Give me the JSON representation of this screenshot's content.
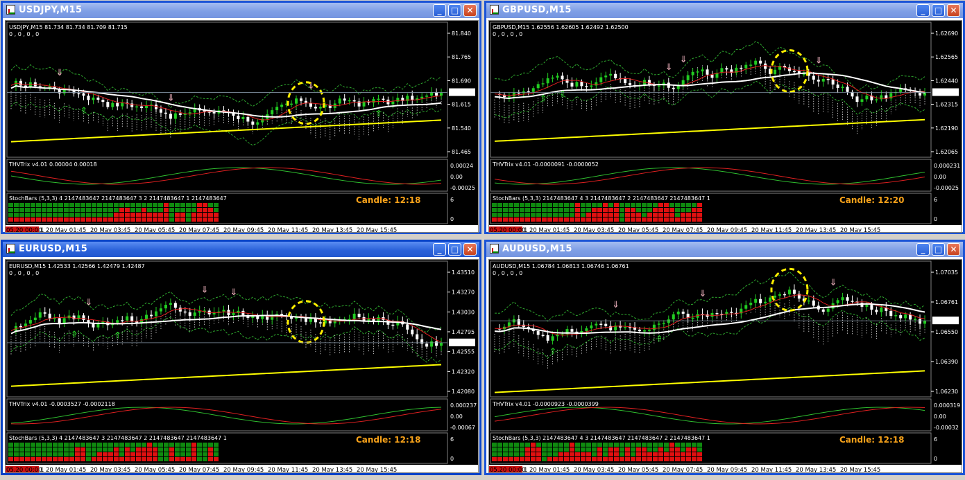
{
  "windows": [
    {
      "id": "usdjpy",
      "title": "USDJPY,M15",
      "header": "USDJPY,M15  81.734 81.734 81.709 81.715",
      "subheader": "0 , 0 , 0 , 0",
      "price_labels": [
        "81.840",
        "81.765",
        "81.690",
        "81.615",
        "81.540",
        "81.465"
      ],
      "current_price": "81.715",
      "indicator": "THVTrix v4.01 0.00004 0.00018",
      "indicator_labels": [
        "0.00024",
        "0.00",
        "-0.00025"
      ],
      "stoch": "StochBars (5,3,3) 4 2147483647 2147483647 3 2 2147483647 1 2147483647",
      "stoch_labels": [
        "6",
        "0"
      ],
      "candle": "Candle:  12:18",
      "time_labels": [
        "05.20 00:00",
        "1",
        "20 May 01:45",
        "20 May 03:45",
        "20 May 05:45",
        "20 May 07:45",
        "20 May 09:45",
        "20 May 11:45",
        "20 May 13:45",
        "20 May 15:45"
      ]
    },
    {
      "id": "gbpusd",
      "title": "GBPUSD,M15",
      "header": "GBPUSD,M15  1.62556 1.62605 1.62492 1.62500",
      "subheader": "0 , 0 , 0 , 0",
      "price_labels": [
        "1.62690",
        "1.62565",
        "1.62440",
        "1.62315",
        "1.62190",
        "1.62065"
      ],
      "current_price": "1.62500",
      "indicator": "THVTrix v4.01 -0.0000091 -0.0000052",
      "indicator_labels": [
        "0.000231",
        "0.00",
        "-0.00025"
      ],
      "stoch": "StochBars (5,3,3) 2147483647 4 3 2147483647 2 2147483647 2147483647 1",
      "stoch_labels": [
        "6",
        "0"
      ],
      "candle": "Candle:  12:20",
      "time_labels": [
        "05.20 00:00",
        "1",
        "20 May 01:45",
        "20 May 03:45",
        "20 May 05:45",
        "20 May 07:45",
        "20 May 09:45",
        "20 May 11:45",
        "20 May 13:45",
        "20 May 15:45"
      ]
    },
    {
      "id": "eurusd",
      "title": "EURUSD,M15",
      "header": "EURUSD,M15  1.42533 1.42566 1.42479 1.42487",
      "subheader": "0 , 0 , 0 , 0",
      "price_labels": [
        "1.43510",
        "1.43270",
        "1.43030",
        "1.42795",
        "1.42555",
        "1.42320",
        "1.42080"
      ],
      "current_price": "1.42487",
      "indicator": "THVTrix v4.01 -0.0003527 -0.0002118",
      "indicator_labels": [
        "0.000237",
        "0.00",
        "-0.00067"
      ],
      "stoch": "StochBars (5,3,3) 4 2147483647 3 2147483647 2 2147483647 2147483647 1",
      "stoch_labels": [
        "6",
        "0"
      ],
      "candle": "Candle:  12:18",
      "time_labels": [
        "05.20 00:00",
        "1",
        "20 May 01:45",
        "20 May 03:45",
        "20 May 05:45",
        "20 May 07:45",
        "20 May 09:45",
        "20 May 11:45",
        "20 May 13:45",
        "20 May 15:45"
      ]
    },
    {
      "id": "audusd",
      "title": "AUDUSD,M15",
      "header": "AUDUSD,M15  1.06784 1.06813 1.06746 1.06761",
      "subheader": "0 , 0 , 0 , 0",
      "price_labels": [
        "1.07035",
        "1.06761",
        "1.06550",
        "1.06390",
        "1.06230"
      ],
      "current_price": "1.06761",
      "indicator": "THVTrix v4.01 -0.0000923 -0.0000399",
      "indicator_labels": [
        "0.000319",
        "0.00",
        "-0.00032"
      ],
      "stoch": "StochBars (5,3,3) 2147483647 4 3 2147483647 2147483647 2 2147483647 1",
      "stoch_labels": [
        "6",
        "0"
      ],
      "candle": "Candle:  12:18",
      "time_labels": [
        "05.20 00:00",
        "1",
        "20 May 01:45",
        "20 May 03:45",
        "20 May 05:45",
        "20 May 07:45",
        "20 May 09:45",
        "20 May 11:45",
        "20 May 13:45",
        "20 May 15:45"
      ]
    }
  ],
  "colors": {
    "titlebar_active": "#2b62da",
    "titlebar_inactive": "#7f9fe6",
    "chart_bg": "#000000",
    "bull": "#22cc22",
    "bear": "#ffffff",
    "ma_slow": "#ffff00",
    "stoch_green": "#0f8a0f",
    "stoch_red": "#e01010",
    "candle_text": "#f7a21a"
  },
  "icons": {
    "minimize": "minimize-icon",
    "maximize": "maximize-icon",
    "close": "close-icon",
    "window": "chart-window-icon"
  }
}
